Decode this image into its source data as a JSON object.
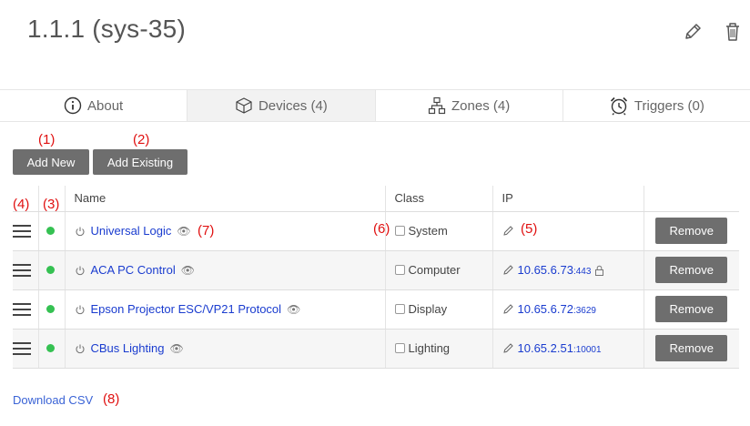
{
  "page": {
    "title": "1.1.1 (sys-35)"
  },
  "title_actions": {
    "edit_icon": "pencil-icon",
    "delete_icon": "trash-icon"
  },
  "tabs": [
    {
      "label": "About",
      "icon": "info-circle-icon",
      "active": false
    },
    {
      "label": "Devices (4)",
      "icon": "cube-icon",
      "active": true
    },
    {
      "label": "Zones (4)",
      "icon": "sitemap-icon",
      "active": false
    },
    {
      "label": "Triggers (0)",
      "icon": "alarm-clock-icon",
      "active": false
    }
  ],
  "annotations": {
    "a1": "(1)",
    "a2": "(2)",
    "a3": "(3)",
    "a4": "(4)",
    "a5": "(5)",
    "a6": "(6)",
    "a7": "(7)",
    "a8": "(8)"
  },
  "toolbar": {
    "add_new_label": "Add New",
    "add_existing_label": "Add Existing"
  },
  "table": {
    "headers": {
      "name": "Name",
      "class": "Class",
      "ip": "IP"
    },
    "rows": [
      {
        "name": "Universal Logic",
        "class": "System",
        "ip": "",
        "port": "",
        "locked": false,
        "status_color": "#35c152"
      },
      {
        "name": "ACA PC Control",
        "class": "Computer",
        "ip": "10.65.6.73",
        "port": ":443",
        "locked": true,
        "status_color": "#35c152"
      },
      {
        "name": "Epson Projector ESC/VP21 Protocol",
        "class": "Display",
        "ip": "10.65.6.72",
        "port": ":3629",
        "locked": false,
        "status_color": "#35c152"
      },
      {
        "name": "CBus Lighting",
        "class": "Lighting",
        "ip": "10.65.2.51",
        "port": ":10001",
        "locked": false,
        "status_color": "#35c152"
      }
    ],
    "remove_label": "Remove"
  },
  "footer": {
    "download_csv_label": "Download CSV"
  }
}
